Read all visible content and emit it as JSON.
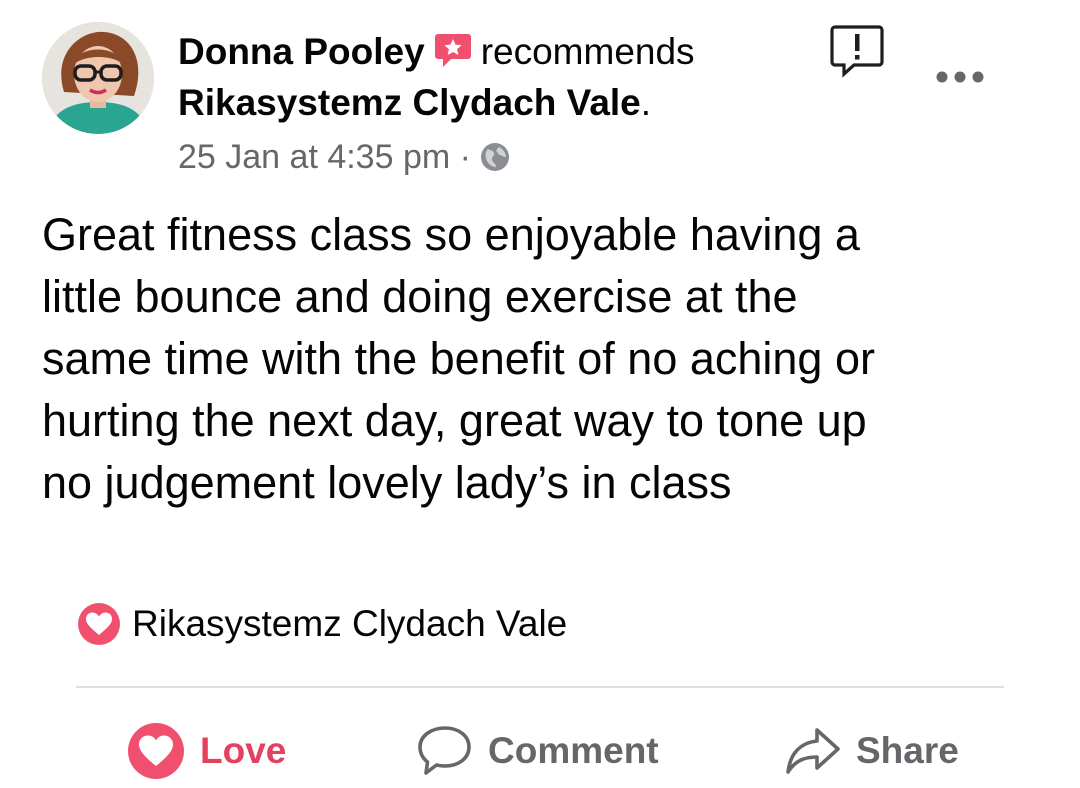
{
  "post": {
    "author": "Donna Pooley",
    "recommends_text": "recommends",
    "page": "Rikasystemz Clydach Vale",
    "page_suffix": ".",
    "timestamp": "25 Jan at 4:35 pm",
    "timestamp_sep": "·",
    "privacy_icon": "globe-icon",
    "body": "Great fitness class so enjoyable having a\nlittle bounce and doing exercise at the\nsame time with the benefit of no aching or\nhurting the next day, great way to tone up\nno judgement lovely lady’s in class"
  },
  "tagged_page": {
    "icon": "heart-icon",
    "label": "Rikasystemz Clydach Vale"
  },
  "actions": {
    "love_label": "Love",
    "comment_label": "Comment",
    "share_label": "Share"
  },
  "colors": {
    "accent_red": "#e4405f",
    "text_secondary": "#65676b",
    "divider": "#dddfe2"
  }
}
